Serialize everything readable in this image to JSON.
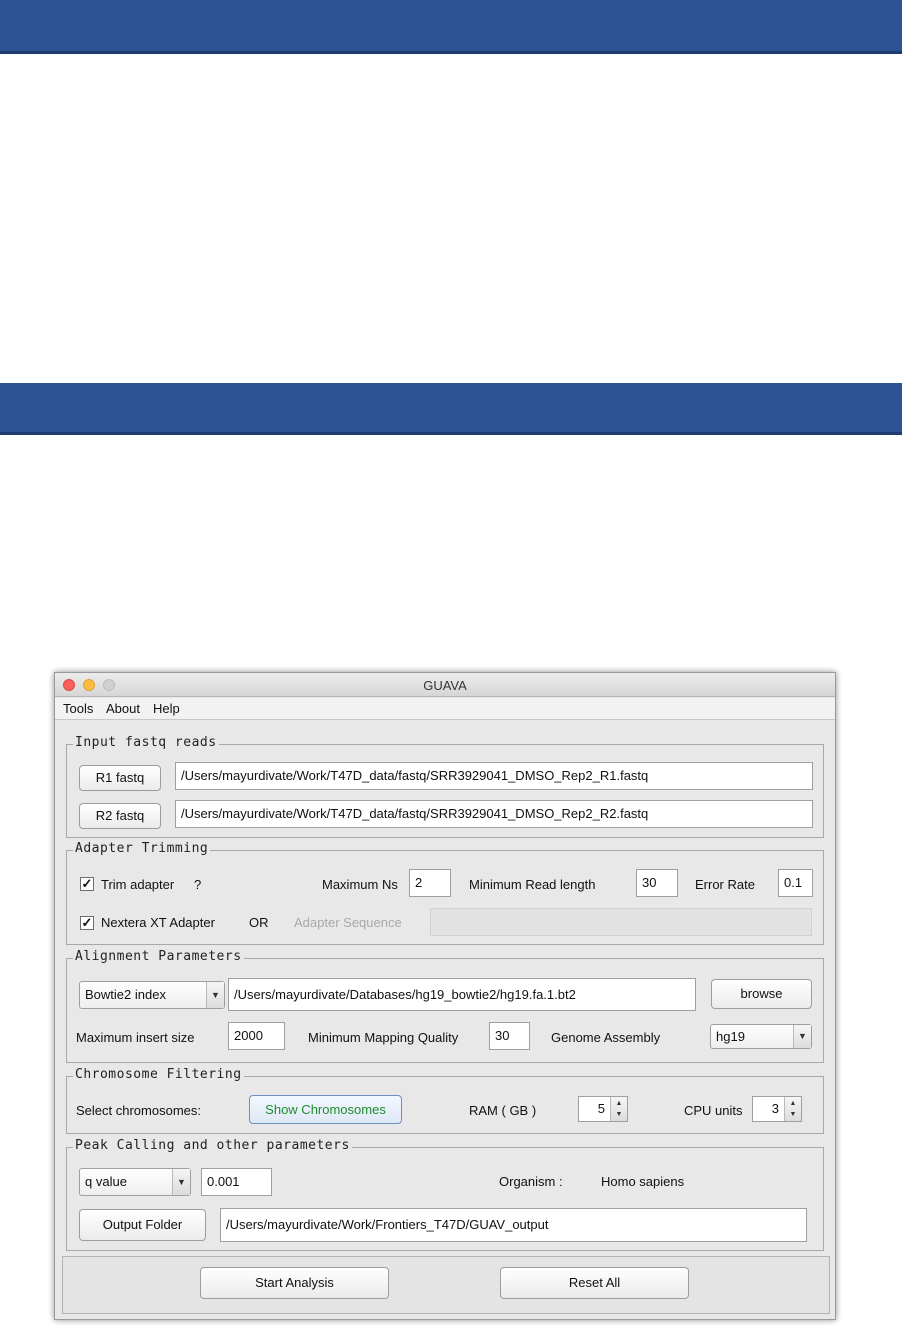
{
  "window": {
    "title": "GUAVA"
  },
  "menu": {
    "items": [
      "Tools",
      "About",
      "Help"
    ]
  },
  "input": {
    "legend": "Input fastq reads",
    "r1_label": "R1 fastq",
    "r1_path": "/Users/mayurdivate/Work/T47D_data/fastq/SRR3929041_DMSO_Rep2_R1.fastq",
    "r2_label": "R2 fastq",
    "r2_path": "/Users/mayurdivate/Work/T47D_data/fastq/SRR3929041_DMSO_Rep2_R2.fastq"
  },
  "adapter": {
    "legend": "Adapter Trimming",
    "trim_label": "Trim adapter",
    "trim_help": "?",
    "trim_checked": true,
    "max_ns_label": "Maximum Ns",
    "max_ns": "2",
    "min_read_label": "Minimum Read length",
    "min_read": "30",
    "error_rate_label": "Error Rate",
    "error_rate": "0.1",
    "nextera_label": "Nextera XT Adapter",
    "nextera_checked": true,
    "or_label": "OR",
    "adapter_seq_label": "Adapter Sequence",
    "adapter_seq": ""
  },
  "alignment": {
    "legend": "Alignment Parameters",
    "index_type": "Bowtie2 index",
    "index_path": "/Users/mayurdivate/Databases/hg19_bowtie2/hg19.fa.1.bt2",
    "browse_label": "browse",
    "max_insert_label": "Maximum insert size",
    "max_insert": "2000",
    "min_mapq_label": "Minimum Mapping Quality",
    "min_mapq": "30",
    "assembly_label": "Genome Assembly",
    "assembly": "hg19"
  },
  "chromosome": {
    "legend": "Chromosome Filtering",
    "select_label": "Select chromosomes:",
    "show_button": "Show Chromosomes",
    "show_button_color": "#1e8c2e",
    "ram_label": "RAM ( GB )",
    "ram": "5",
    "cpu_label": "CPU units",
    "cpu": "3"
  },
  "peak": {
    "legend": "Peak Calling and other parameters",
    "cutoff_type": "q value",
    "cutoff_value": "0.001",
    "organism_label": "Organism :",
    "organism": "Homo sapiens",
    "output_button": "Output Folder",
    "output_path": "/Users/mayurdivate/Work/Frontiers_T47D/GUAV_output"
  },
  "actions": {
    "start": "Start Analysis",
    "reset": "Reset All"
  },
  "colors": {
    "band": "#2d5394"
  }
}
